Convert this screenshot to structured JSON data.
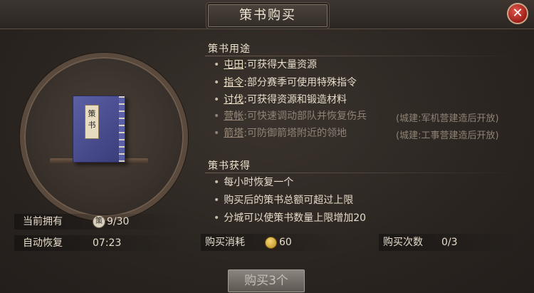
{
  "window": {
    "title": "策书购买",
    "close_icon": "close-icon"
  },
  "item": {
    "book_label": "策书",
    "icon": "book-icon"
  },
  "stats": {
    "owned_label": "当前拥有",
    "owned_token": "策",
    "owned_value": "9/30",
    "recover_label": "自动恢复",
    "recover_value": "07:23"
  },
  "usage": {
    "title": "策书用途",
    "items": [
      {
        "key": "屯田",
        "desc": ":可获得大量资源",
        "note": "",
        "enabled": true
      },
      {
        "key": "指令",
        "desc": ":部分赛季可使用特殊指令",
        "note": "",
        "enabled": true
      },
      {
        "key": "讨伐",
        "desc": ":可获得资源和锻造材料",
        "note": "",
        "enabled": true
      },
      {
        "key": "营帐",
        "desc": ":可快速调动部队并恢复伤兵",
        "note": "(城建:军机营建造后开放)",
        "enabled": false
      },
      {
        "key": "箭塔",
        "desc": ":可防御箭塔附近的领地",
        "note": "(城建:工事营建造后开放)",
        "enabled": false
      }
    ]
  },
  "obtain": {
    "title": "策书获得",
    "items": [
      "每小时恢复一个",
      "购买后的策书总额可超过上限",
      "分城可以使策书数量上限增加20"
    ]
  },
  "purchase": {
    "cost_label": "购买消耗",
    "cost_value": "60",
    "count_label": "购买次数",
    "count_value": "0/3",
    "buy_button": "购买3个"
  }
}
